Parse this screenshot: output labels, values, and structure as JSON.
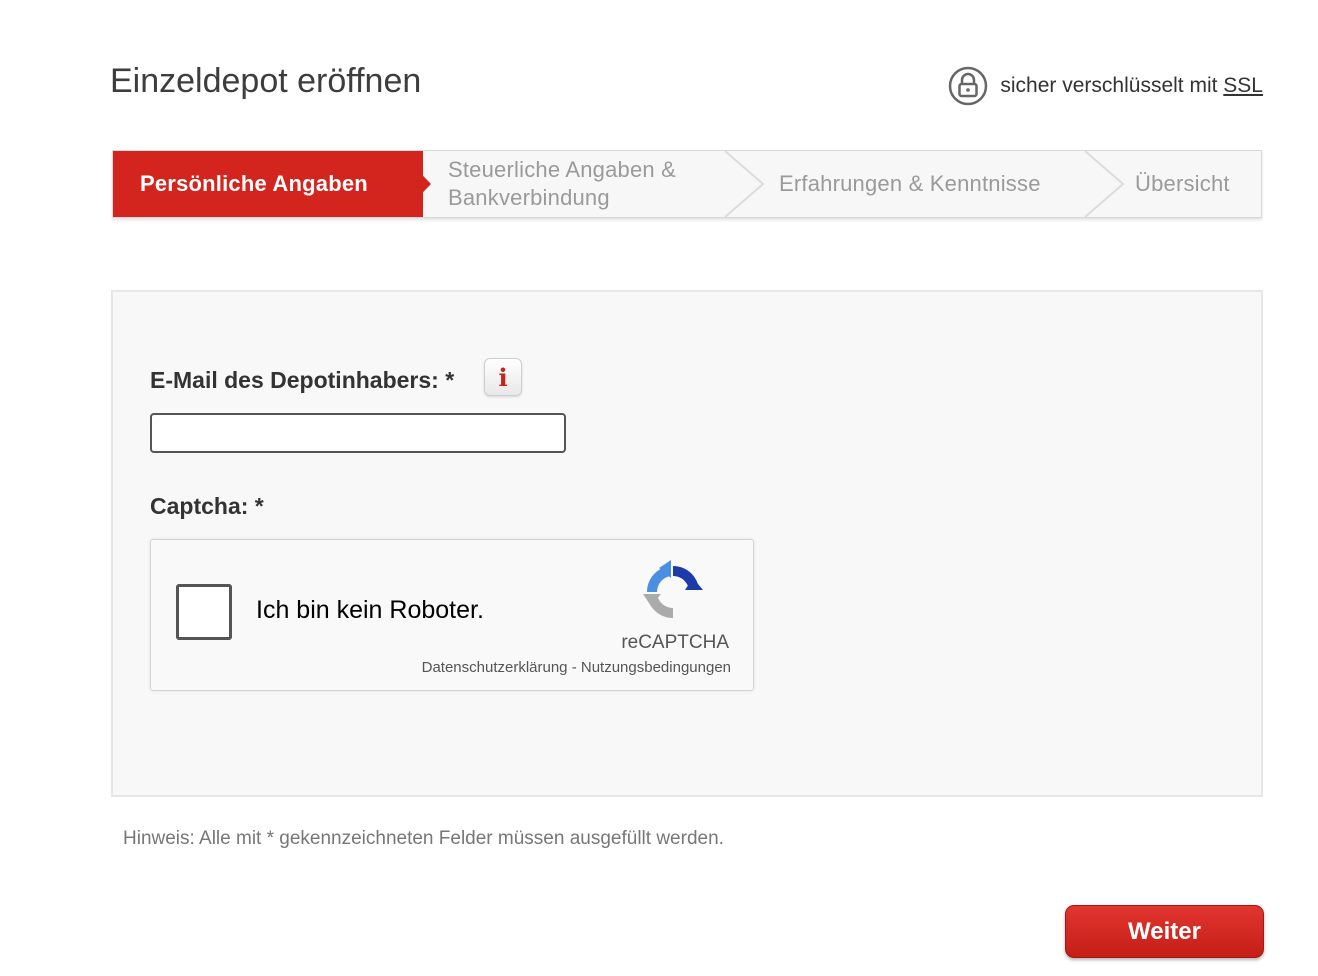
{
  "header": {
    "title": "Einzeldepot eröffnen",
    "ssl_text": "sicher verschlüsselt mit",
    "ssl_link": "SSL",
    "lock_icon": "lock-icon"
  },
  "stepper": {
    "steps": [
      {
        "label": "Persönliche Angaben",
        "state": "active"
      },
      {
        "label_line1": "Steuerliche Angaben &",
        "label_line2": "Bankverbindung",
        "state": "inactive"
      },
      {
        "label": "Erfahrungen & Kenntnisse",
        "state": "inactive"
      },
      {
        "label": "Übersicht",
        "state": "inactive"
      }
    ]
  },
  "form": {
    "email_label": "E-Mail des Depotinhabers: *",
    "email_value": "",
    "info_icon": "i",
    "captcha_label": "Captcha: *",
    "recaptcha": {
      "checkbox_label": "Ich bin kein Roboter.",
      "brand": "reCAPTCHA",
      "privacy_link": "Datenschutzerklärung",
      "separator": " - ",
      "terms_link": "Nutzungsbedingungen"
    }
  },
  "hint": "Hinweis: Alle mit * gekennzeichneten Felder müssen ausgefüllt werden.",
  "actions": {
    "next_label": "Weiter"
  },
  "colors": {
    "accent": "#d3241d",
    "panel_bg": "#f8f8f8"
  }
}
